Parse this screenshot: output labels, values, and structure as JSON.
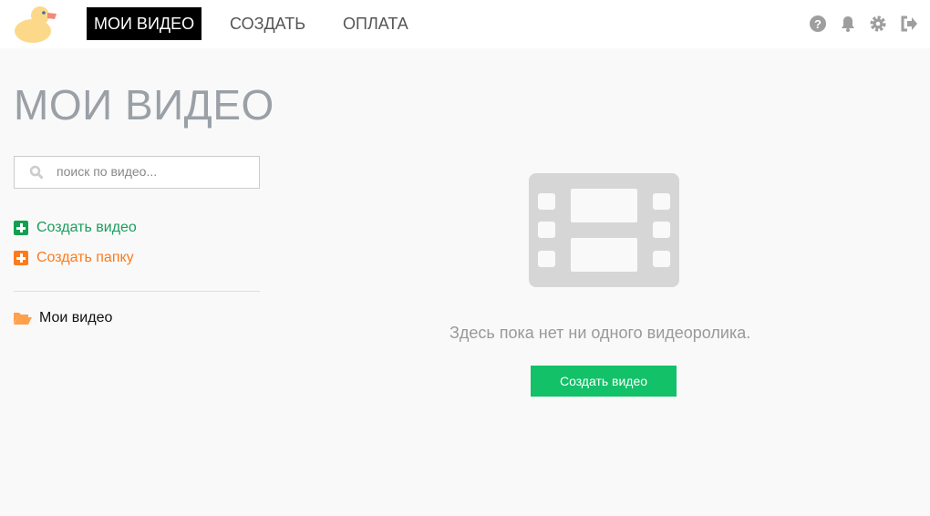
{
  "header": {
    "nav": [
      {
        "label": "МОИ ВИДЕО",
        "active": true
      },
      {
        "label": "СОЗДАТЬ"
      },
      {
        "label": "ОПЛАТА"
      }
    ],
    "icons": [
      "help-icon",
      "bell-icon",
      "gear-icon",
      "logout-icon"
    ]
  },
  "page": {
    "title": "МОИ ВИДЕО"
  },
  "sidebar": {
    "search_placeholder": "поиск по видео...",
    "create_video": "Создать видео",
    "create_folder": "Создать папку",
    "folder": "Мои видео"
  },
  "main": {
    "empty_text": "Здесь пока нет ни одного видеоролика.",
    "create_button": "Создать видео"
  },
  "colors": {
    "green": "#12c168",
    "link_green": "#1a9e5c",
    "orange": "#ff7a1a",
    "icon_gray": "#9e9e9e"
  }
}
